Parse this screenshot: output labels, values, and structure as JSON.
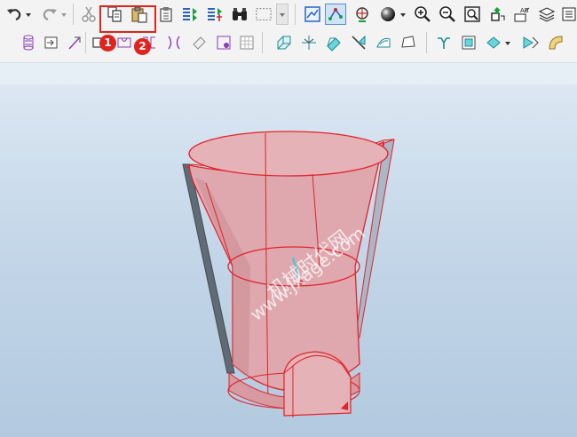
{
  "toolbar": {
    "row1_tools": [
      "undo",
      "undo-dropdown",
      "redo",
      "redo-dropdown",
      "cut",
      "copy",
      "paste",
      "paste-special",
      "regenerate",
      "regenerate-manager",
      "find",
      "select-box",
      "select-dropdown",
      "view-manager",
      "datum-display",
      "spin-center",
      "appearance",
      "appearance-dropdown",
      "zoom-in",
      "zoom-out",
      "refit",
      "reorient",
      "annotation",
      "layers"
    ],
    "row2_tools": [
      "cylinder",
      "import",
      "datum-axis",
      "rectangle",
      "sketch",
      "mirror",
      "copy-geometry",
      "group",
      "pattern",
      "blend",
      "sweep",
      "extend",
      "trim",
      "surface",
      "boundary",
      "offset",
      "thicken",
      "solidify",
      "merge",
      "round"
    ]
  },
  "callouts": {
    "copy_badge": "1",
    "paste_badge": "2"
  },
  "watermark": {
    "cn_text": "机械时代网",
    "url_text": "www.jxage.com"
  },
  "colors": {
    "highlight": "#e0231c",
    "model_fill": "#e8a8ae",
    "model_edge": "#e2232a",
    "viewport_top": "#dce7f2",
    "viewport_bottom": "#b2c9df"
  }
}
